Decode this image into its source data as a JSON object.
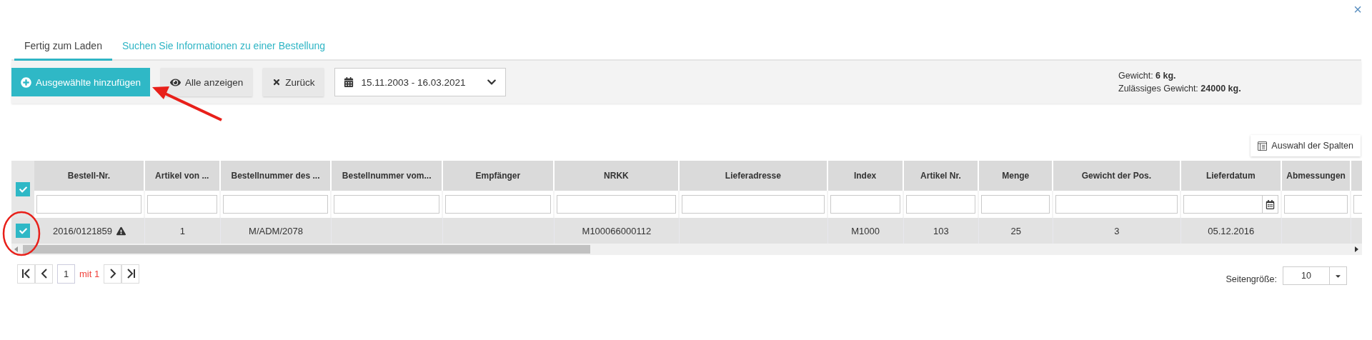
{
  "close_button": "×",
  "tabs": [
    {
      "label": "Fertig zum Laden",
      "selected": true
    },
    {
      "label": "Suchen Sie Informationen zu einer Bestellung",
      "selected": false
    }
  ],
  "toolbar": {
    "buttons": [
      {
        "kind": "primary",
        "label": "Ausgewählte hinzufügen"
      },
      {
        "kind": "default",
        "label": "Alle anzeigen"
      },
      {
        "kind": "default",
        "label": "Zurück"
      }
    ],
    "date_range": "15.11.2003 - 16.03.2021",
    "info": [
      "Gewicht: **6 kg.**",
      "Zulässiges Gewicht: **24000 kg.**"
    ]
  },
  "column_chooser": "Auswahl der Spalten",
  "table": {
    "all_checked": true,
    "columns": [
      {
        "label": "Bestell-Nr.",
        "kind": "text"
      },
      {
        "label": "Artikel von ...",
        "kind": "text"
      },
      {
        "label": "Bestellnummer des ...",
        "kind": "text"
      },
      {
        "label": "Bestellnummer vom...",
        "kind": "text"
      },
      {
        "label": "Empfänger",
        "kind": "text"
      },
      {
        "label": "NRKK",
        "kind": "text"
      },
      {
        "label": "Lieferadresse",
        "kind": "text"
      },
      {
        "label": "Index",
        "kind": "text"
      },
      {
        "label": "Artikel Nr.",
        "kind": "text"
      },
      {
        "label": "Menge",
        "kind": "text"
      },
      {
        "label": "Gewicht der Pos.",
        "kind": "text"
      },
      {
        "label": "Lieferdatum",
        "kind": "date"
      },
      {
        "label": "Abmessungen",
        "kind": "text"
      },
      {
        "kind": "text"
      }
    ],
    "rows": [
      {
        "selected": true,
        "checked": true,
        "warning": true,
        "cells": [
          "2016/0121859",
          "1",
          "M/ADM/2078",
          "",
          "",
          "M100066000112",
          "",
          "M1000",
          "103",
          "25",
          "3",
          "05.12.2016",
          "",
          ""
        ]
      }
    ]
  },
  "pager": {
    "page": "1",
    "of_text": "mit 1"
  },
  "page_size": {
    "label": "Seitengröße:",
    "value": "10"
  }
}
